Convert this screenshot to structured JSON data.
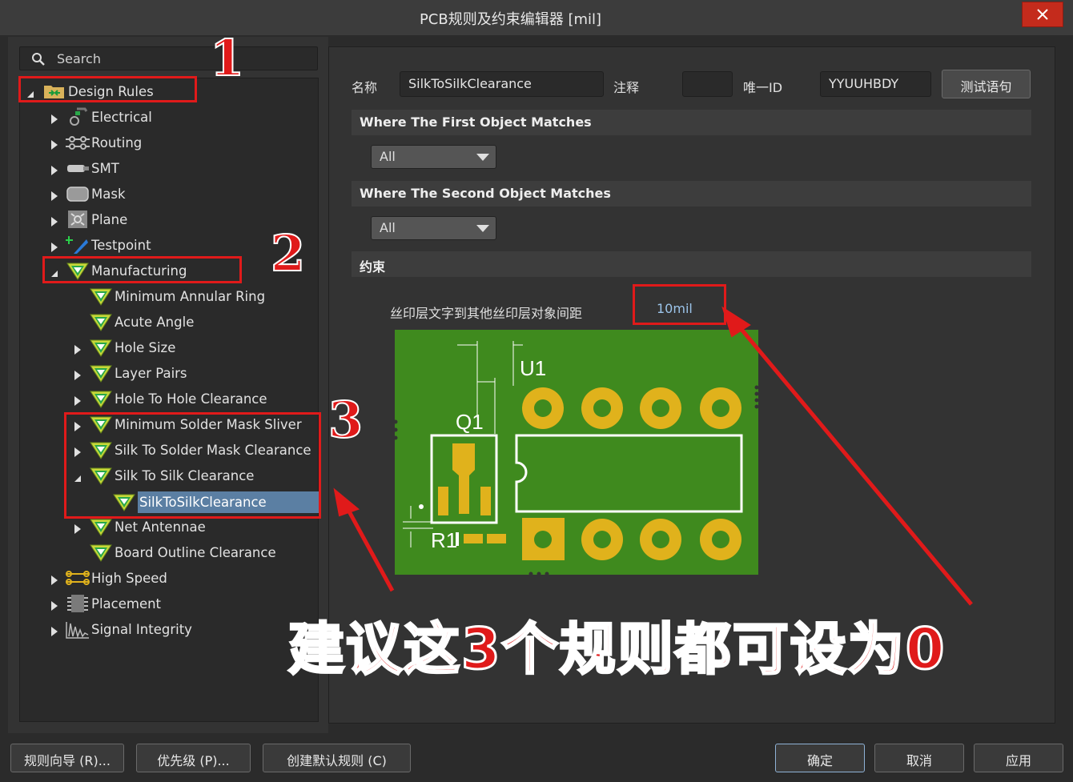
{
  "window": {
    "title": "PCB规则及约束编辑器 [mil]"
  },
  "search": {
    "placeholder": "Search"
  },
  "tree": {
    "root": "Design Rules",
    "electrical": "Electrical",
    "routing": "Routing",
    "smt": "SMT",
    "mask": "Mask",
    "plane": "Plane",
    "testpoint": "Testpoint",
    "manufacturing": "Manufacturing",
    "mfg_items": {
      "min_annular_ring": "Minimum Annular Ring",
      "acute_angle": "Acute Angle",
      "hole_size": "Hole Size",
      "layer_pairs": "Layer Pairs",
      "hole_to_hole": "Hole To Hole Clearance",
      "min_solder_mask_sliver": "Minimum Solder Mask Sliver",
      "silk_to_solder_mask": "Silk To Solder Mask Clearance",
      "silk_to_silk": "Silk To Silk Clearance",
      "silk_to_silk_rule": "SilkToSilkClearance",
      "net_antennae": "Net Antennae",
      "board_outline": "Board Outline Clearance"
    },
    "high_speed": "High Speed",
    "placement": "Placement",
    "signal_integrity": "Signal Integrity"
  },
  "rule": {
    "name_label": "名称",
    "name_value": "SilkToSilkClearance",
    "comment_label": "注释",
    "comment_value": "",
    "uid_label": "唯一ID",
    "uid_value": "YYUUHBDY",
    "test_button": "测试语句",
    "first_match_header": "Where The First Object Matches",
    "first_match_value": "All",
    "second_match_header": "Where The Second Object Matches",
    "second_match_value": "All",
    "constraints_header": "约束",
    "constraint_label": "丝印层文字到其他丝印层对象间距",
    "constraint_value": "10mil"
  },
  "pcb_labels": {
    "u1": "U1",
    "q1": "Q1",
    "r1": "R1"
  },
  "annotations": {
    "n1": "1",
    "n2": "2",
    "n3": "3",
    "caption": "建议这3个规则都可设为0"
  },
  "footer": {
    "rule_wizard": "规则向导 (R)...",
    "priorities": "优先级 (P)...",
    "create_default": "创建默认规则 (C)",
    "ok": "确定",
    "cancel": "取消",
    "apply": "应用"
  },
  "colors": {
    "annotation_red": "#e01a1a",
    "selection": "#5b7fa3",
    "pcb_green": "#3f8a1e",
    "pad_gold": "#e0b21c"
  }
}
